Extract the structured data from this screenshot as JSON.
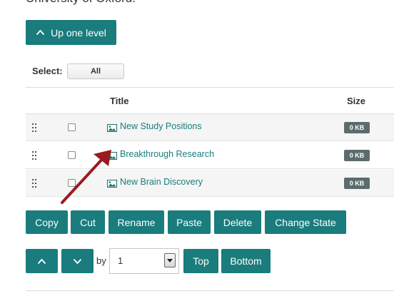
{
  "header": {
    "text": "University of Oxford."
  },
  "nav": {
    "up_label": "Up one level"
  },
  "select": {
    "label": "Select:",
    "all_label": "All"
  },
  "table": {
    "columns": {
      "title": "Title",
      "size": "Size"
    },
    "rows": [
      {
        "title": "New Study Positions",
        "size": "0 KB"
      },
      {
        "title": "Breakthrough Research",
        "size": "0 KB"
      },
      {
        "title": "New Brain Discovery",
        "size": "0 KB"
      }
    ]
  },
  "actions": {
    "copy": "Copy",
    "cut": "Cut",
    "rename": "Rename",
    "paste": "Paste",
    "delete": "Delete",
    "change_state": "Change State"
  },
  "move": {
    "by_label": "by",
    "value": "1",
    "top_label": "Top",
    "bottom_label": "Bottom"
  },
  "colors": {
    "accent": "#1a7c7c",
    "badge": "#5c6c6c",
    "annotation_arrow": "#9b1b1f"
  },
  "icons": [
    "chevron-up-icon",
    "chevron-down-icon",
    "drag-handle-icon",
    "image-icon",
    "dropdown-arrow-icon"
  ]
}
